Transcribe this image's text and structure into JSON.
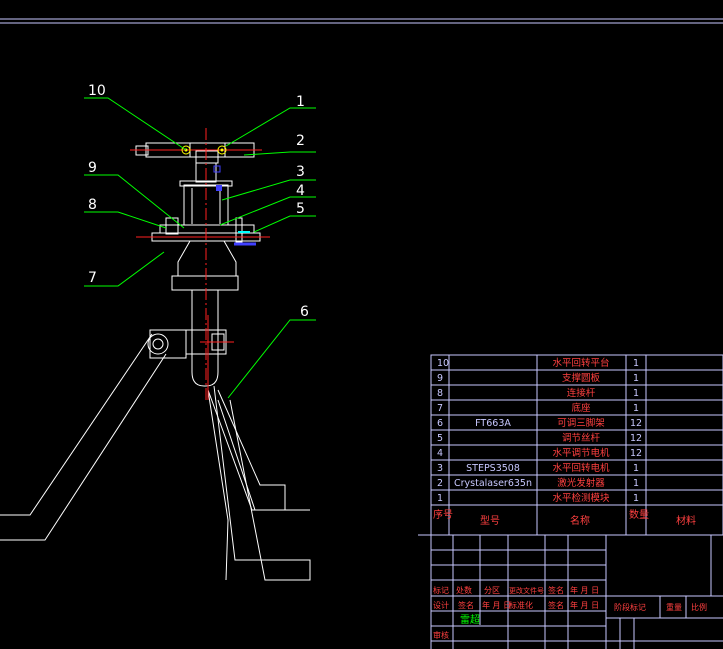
{
  "drawing": {
    "part_labels": [
      "10",
      "9",
      "8",
      "7",
      "1",
      "2",
      "3",
      "4",
      "5",
      "6"
    ]
  },
  "bom": {
    "rows": [
      {
        "no": "10",
        "model": "",
        "name": "水平回转平台",
        "qty": "1",
        "mat": ""
      },
      {
        "no": "9",
        "model": "",
        "name": "支撑圆板",
        "qty": "1",
        "mat": ""
      },
      {
        "no": "8",
        "model": "",
        "name": "连接杆",
        "qty": "1",
        "mat": ""
      },
      {
        "no": "7",
        "model": "",
        "name": "底座",
        "qty": "1",
        "mat": ""
      },
      {
        "no": "6",
        "model": "FT663A",
        "name": "可调三脚架",
        "qty": "12",
        "mat": ""
      },
      {
        "no": "5",
        "model": "",
        "name": "调节丝杆",
        "qty": "12",
        "mat": ""
      },
      {
        "no": "4",
        "model": "",
        "name": "水平调节电机",
        "qty": "12",
        "mat": ""
      },
      {
        "no": "3",
        "model": "STEPS3508",
        "name": "水平回转电机",
        "qty": "1",
        "mat": ""
      },
      {
        "no": "2",
        "model": "Crystalaser635n",
        "name": "激光发射器",
        "qty": "1",
        "mat": ""
      },
      {
        "no": "1",
        "model": "",
        "name": "水平检测模块",
        "qty": "1",
        "mat": ""
      }
    ],
    "header": {
      "no": "序号",
      "model": "型号",
      "name": "名称",
      "qty": "数量",
      "mat": "材料"
    }
  },
  "title_block": {
    "row1": [
      "标记",
      "处数",
      "分区",
      "更改文件号",
      "签名",
      "年 月 日"
    ],
    "row2": [
      "设计",
      "签名",
      "年 月 日",
      "标准化",
      "签名",
      "年 月 日"
    ],
    "designer": "雷超",
    "review": "审核",
    "stage": "阶段标记",
    "weight": "重量",
    "scale": "比例"
  },
  "colors": {
    "line": "#ffffff",
    "leader": "#00ff00",
    "center": "#ff2020",
    "hidden": "#00ffff",
    "accent": "#ffff00",
    "frame": "#c8c8ff"
  }
}
